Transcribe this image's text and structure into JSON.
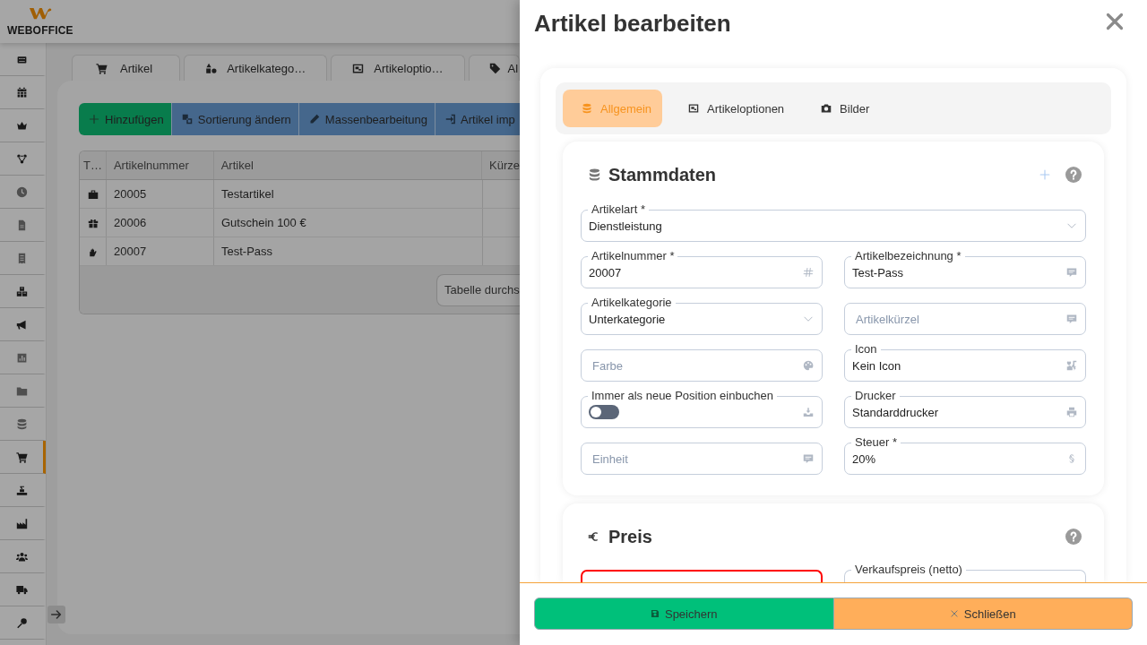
{
  "app": {
    "logo_text": "WEBOFFICE"
  },
  "sidebar": {
    "items": [
      {
        "selected": false
      },
      {
        "selected": false
      },
      {
        "selected": false
      },
      {
        "selected": false
      },
      {
        "selected": false
      },
      {
        "selected": false
      },
      {
        "selected": false
      },
      {
        "selected": false
      },
      {
        "selected": false
      },
      {
        "selected": false
      },
      {
        "selected": false
      },
      {
        "selected": false
      },
      {
        "selected": true
      },
      {
        "selected": false
      },
      {
        "selected": false
      },
      {
        "selected": false
      },
      {
        "selected": false
      },
      {
        "selected": false
      }
    ]
  },
  "page_tabs": [
    {
      "label": "Artikel"
    },
    {
      "label": "Artikelkatego…"
    },
    {
      "label": "Artikeloptio…"
    },
    {
      "label": "Al"
    }
  ],
  "toolbar": [
    {
      "label": "Hinzufügen",
      "kind": "add"
    },
    {
      "label": "Sortierung ändern",
      "kind": "sort"
    },
    {
      "label": "Massenbearbeitung",
      "kind": "bulk-edit"
    },
    {
      "label": "Artikel imp",
      "kind": "import"
    }
  ],
  "table": {
    "columns": [
      "T…",
      "Artikelnummer",
      "Artikel",
      "Kürze"
    ],
    "rows": [
      {
        "kind": "product",
        "number": "20005",
        "name": "Testartikel"
      },
      {
        "kind": "voucher",
        "number": "20006",
        "name": "Gutschein 100 €"
      },
      {
        "kind": "service",
        "number": "20007",
        "name": "Test-Pass"
      }
    ],
    "search": {
      "placeholder": "Tabelle durchs"
    }
  },
  "drawer": {
    "title": "Artikel bearbeiten",
    "tabs": [
      {
        "label": "Allgemein",
        "selected": true
      },
      {
        "label": "Artikeloptionen",
        "selected": false
      },
      {
        "label": "Bilder",
        "selected": false
      }
    ],
    "sections": [
      {
        "kind": "master-data",
        "title": "Stammdaten",
        "addable": true,
        "rows": [
          {
            "fields": [
              {
                "kind": "select",
                "label": "Artikelart *",
                "value": "Dienstleistung"
              }
            ]
          },
          {
            "fields": [
              {
                "kind": "number",
                "label": "Artikelnummer *",
                "value": "20007"
              },
              {
                "kind": "text",
                "label": "Artikelbezeichnung *",
                "value": "Test-Pass"
              }
            ]
          },
          {
            "fields": [
              {
                "kind": "select",
                "label": "Artikelkategorie",
                "value": "Unterkategorie"
              },
              {
                "kind": "text",
                "placeholder": "Artikelkürzel"
              }
            ]
          },
          {
            "fields": [
              {
                "kind": "color",
                "placeholder": "Farbe"
              },
              {
                "kind": "iconpicker",
                "label": "Icon",
                "value": "Kein Icon"
              }
            ]
          },
          {
            "fields": [
              {
                "kind": "toggle",
                "label": "Immer als neue Position einbuchen",
                "on": false
              },
              {
                "kind": "printer",
                "label": "Drucker",
                "value": "Standarddrucker"
              }
            ]
          },
          {
            "fields": [
              {
                "kind": "text",
                "placeholder": "Einheit"
              },
              {
                "kind": "tax",
                "label": "Steuer *",
                "value": "20%"
              }
            ]
          }
        ]
      },
      {
        "kind": "price",
        "title": "Preis",
        "addable": false,
        "rows": [
          {
            "fields": [
              {
                "kind": "currency",
                "invalid": true
              },
              {
                "kind": "currency",
                "label": "Verkaufspreis (netto)",
                "invalid": false
              }
            ]
          }
        ]
      }
    ],
    "buttons": [
      {
        "label": "Speichern",
        "kind": "save"
      },
      {
        "label": "Schließen",
        "kind": "close"
      }
    ]
  }
}
